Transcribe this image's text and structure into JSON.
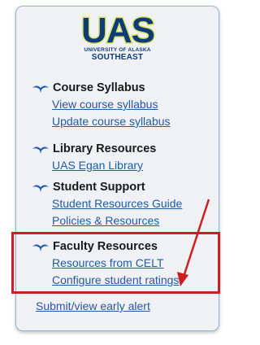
{
  "logo": {
    "mark": "UAS",
    "line1": "UNIVERSITY OF ALASKA",
    "line2": "SOUTHEAST",
    "colors": {
      "fill": "#0f3b7a",
      "outline": "#d8e45a"
    }
  },
  "sections": [
    {
      "title": "Course Syllabus",
      "icon": "whale-icon",
      "links": [
        "View course syllabus",
        "Update course syllabus"
      ]
    },
    {
      "title": "Library Resources",
      "icon": "whale-icon",
      "links": [
        "UAS Egan Library"
      ]
    },
    {
      "title": "Student Support",
      "icon": "whale-icon",
      "links": [
        "Student Resources Guide",
        "Policies & Resources"
      ]
    },
    {
      "title": "Faculty Resources",
      "icon": "whale-icon",
      "links": [
        "Resources from CELT",
        "Configure student ratings"
      ]
    }
  ],
  "standalone_link": "Submit/view early alert",
  "annotation": {
    "color": "#cc1f1f"
  }
}
